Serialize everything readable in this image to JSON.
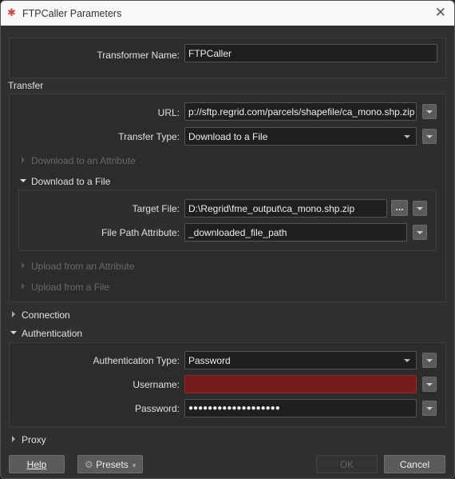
{
  "window": {
    "title": "FTPCaller Parameters",
    "close": "✕",
    "icon": "fme-transformer-icon"
  },
  "transformer_name": {
    "label": "Transformer Name:",
    "value": "FTPCaller"
  },
  "transfer": {
    "heading": "Transfer",
    "url": {
      "label": "URL:",
      "value": "p://sftp.regrid.com/parcels/shapefile/ca_mono.shp.zip"
    },
    "transfer_type": {
      "label": "Transfer Type:",
      "value": "Download to a File"
    },
    "download_to_attribute": "Download to an Attribute",
    "download_to_file": {
      "heading": "Download to a File",
      "target_file": {
        "label": "Target File:",
        "value": "D:\\Regrid\\fme_output\\ca_mono.shp.zip",
        "browse": "..."
      },
      "file_path_attribute": {
        "label": "File Path Attribute:",
        "value": "_downloaded_file_path"
      }
    },
    "upload_from_attribute": "Upload from an Attribute",
    "upload_from_file": "Upload from a File"
  },
  "connection": {
    "heading": "Connection"
  },
  "authentication": {
    "heading": "Authentication",
    "type": {
      "label": "Authentication Type:",
      "value": "Password"
    },
    "username": {
      "label": "Username:",
      "value": "",
      "error_color": "#761a1a"
    },
    "password": {
      "label": "Password:",
      "value": "●●●●●●●●●●●●●●●●●●●"
    }
  },
  "proxy": {
    "heading": "Proxy"
  },
  "buttons": {
    "help": "Help",
    "presets": "Presets",
    "ok": "OK",
    "cancel": "Cancel"
  }
}
